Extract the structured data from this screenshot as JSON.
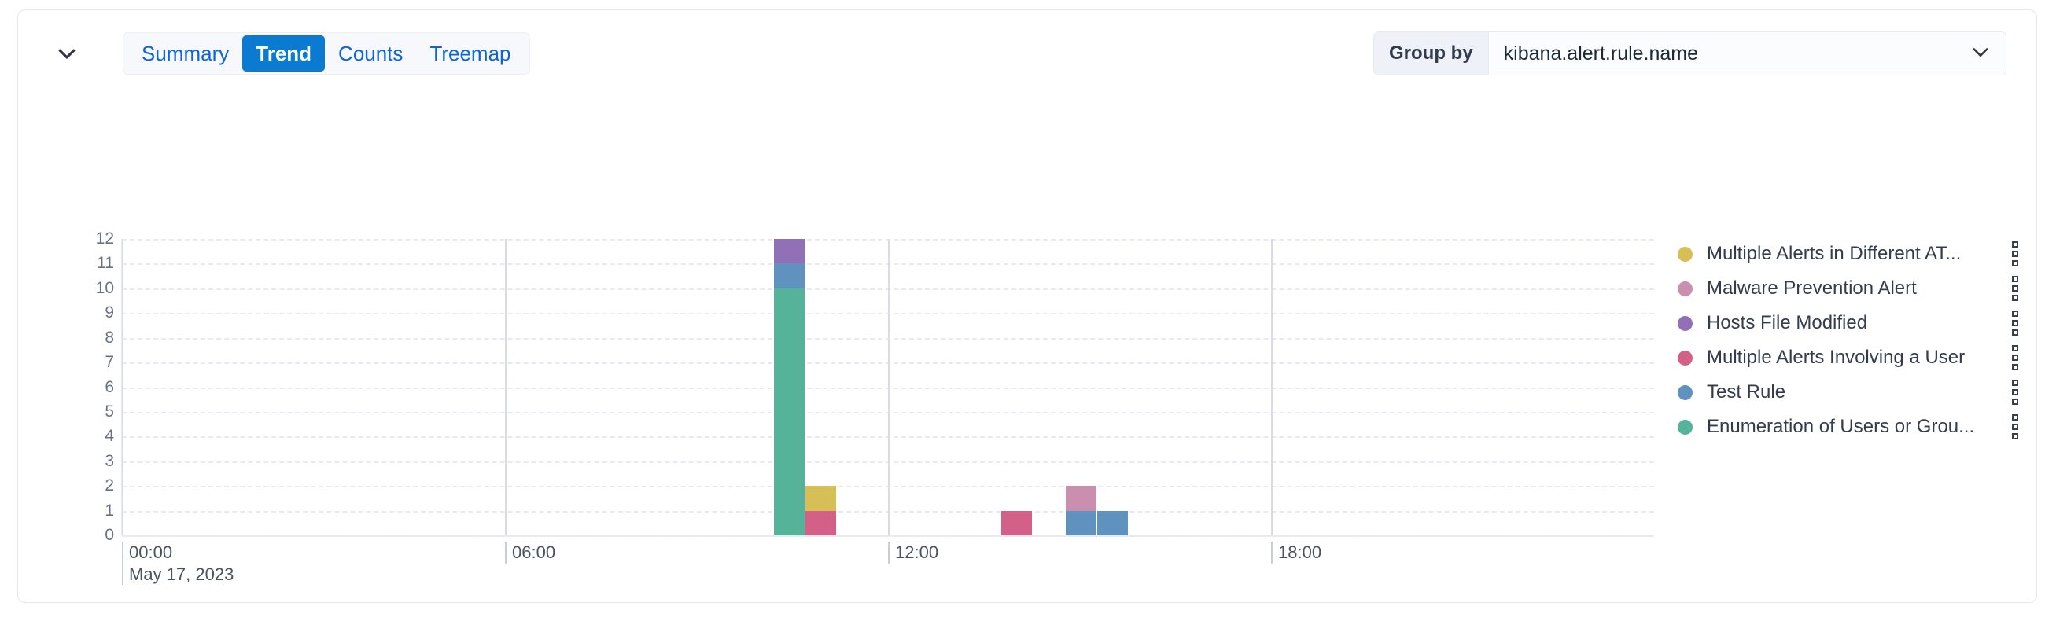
{
  "panel": {
    "collapse_icon": "chevron-down-icon"
  },
  "tabs": [
    {
      "label": "Summary",
      "active": false
    },
    {
      "label": "Trend",
      "active": true
    },
    {
      "label": "Counts",
      "active": false
    },
    {
      "label": "Treemap",
      "active": false
    }
  ],
  "group_by": {
    "label": "Group by",
    "value": "kibana.alert.rule.name",
    "chevron_icon": "chevron-down-icon"
  },
  "chart_data": {
    "type": "bar",
    "stacked": true,
    "title": "",
    "xlabel": "",
    "ylabel": "",
    "ylim": [
      0,
      12
    ],
    "yticks": [
      12,
      11,
      10,
      9,
      8,
      7,
      6,
      5,
      4,
      3,
      2,
      1,
      0
    ],
    "grid": true,
    "legend_position": "right",
    "x_axis_date": "May 17, 2023",
    "xticks": [
      {
        "label": "00:00",
        "sub": "May 17, 2023",
        "hour": 0
      },
      {
        "label": "06:00",
        "sub": "",
        "hour": 6
      },
      {
        "label": "12:00",
        "sub": "",
        "hour": 12
      },
      {
        "label": "18:00",
        "sub": "",
        "hour": 18
      }
    ],
    "x_range_hours": [
      0,
      24
    ],
    "series": [
      {
        "name": "Multiple Alerts in Different AT...",
        "color": "#d6bf57"
      },
      {
        "name": "Malware Prevention Alert",
        "color": "#ca8eae"
      },
      {
        "name": "Hosts File Modified",
        "color": "#9170b8"
      },
      {
        "name": "Multiple Alerts Involving a User",
        "color": "#d36086"
      },
      {
        "name": "Test Rule",
        "color": "#6092c0"
      },
      {
        "name": "Enumeration of Users or Grou...",
        "color": "#54b399"
      }
    ],
    "bars": [
      {
        "hour": 10.45,
        "stack": [
          {
            "series": "Enumeration of Users or Grou...",
            "value": 10,
            "color": "#54b399"
          },
          {
            "series": "Test Rule",
            "value": 1,
            "color": "#6092c0"
          },
          {
            "series": "Hosts File Modified",
            "value": 1,
            "color": "#9170b8"
          }
        ]
      },
      {
        "hour": 10.95,
        "stack": [
          {
            "series": "Multiple Alerts Involving a User",
            "value": 1,
            "color": "#d36086"
          },
          {
            "series": "Multiple Alerts in Different AT...",
            "value": 1,
            "color": "#d6bf57"
          }
        ]
      },
      {
        "hour": 14.02,
        "stack": [
          {
            "series": "Multiple Alerts Involving a User",
            "value": 1,
            "color": "#d36086"
          }
        ]
      },
      {
        "hour": 15.03,
        "stack": [
          {
            "series": "Test Rule",
            "value": 1,
            "color": "#6092c0"
          },
          {
            "series": "Malware Prevention Alert",
            "value": 1,
            "color": "#ca8eae"
          }
        ]
      },
      {
        "hour": 15.52,
        "stack": [
          {
            "series": "Test Rule",
            "value": 1,
            "color": "#6092c0"
          }
        ]
      }
    ]
  },
  "legend": {
    "actions_icon": "more-vertical-icon",
    "items": [
      {
        "label": "Multiple Alerts in Different AT...",
        "color": "#d6bf57"
      },
      {
        "label": "Malware Prevention Alert",
        "color": "#ca8eae"
      },
      {
        "label": "Hosts File Modified",
        "color": "#9170b8"
      },
      {
        "label": "Multiple Alerts Involving a User",
        "color": "#d36086"
      },
      {
        "label": "Test Rule",
        "color": "#6092c0"
      },
      {
        "label": "Enumeration of Users or Grou...",
        "color": "#54b399"
      }
    ]
  }
}
